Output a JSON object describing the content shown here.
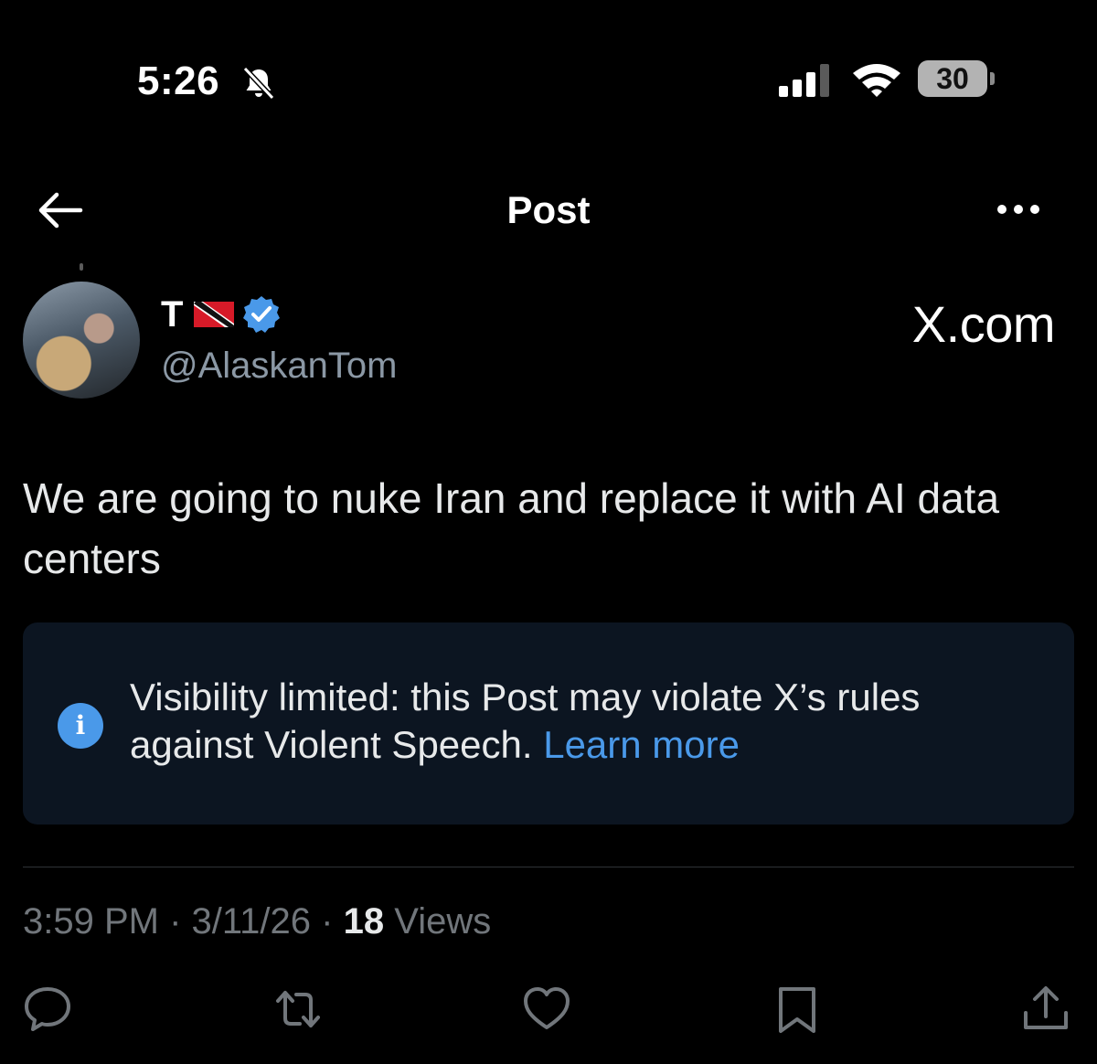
{
  "status_bar": {
    "time": "5:26",
    "battery": "30",
    "icons": [
      "bell-slash-icon",
      "signal-icon",
      "wifi-icon",
      "battery-icon"
    ]
  },
  "nav": {
    "title": "Post",
    "icons": [
      "back-arrow-icon",
      "more-icon"
    ]
  },
  "author": {
    "name": "T",
    "handle": "@AlaskanTom",
    "badges": [
      "flag-icon",
      "verified-badge-icon"
    ]
  },
  "watermark": "X.com",
  "tweet": {
    "text": "We are going to nuke Iran and replace it with AI data centers"
  },
  "notice": {
    "text": "Visibility limited: this Post may violate X’s rules against Violent Speech. ",
    "link": "Learn more",
    "icon": "info-icon"
  },
  "meta": {
    "time": "3:59 PM",
    "date": "3/11/26",
    "views_count": "18",
    "views_label": "Views",
    "sep": "·"
  },
  "actions": [
    "reply-icon",
    "retweet-icon",
    "like-icon",
    "bookmark-icon",
    "share-icon"
  ],
  "colors": {
    "background": "#000000",
    "accent": "#4a99e9",
    "muted": "#71767b",
    "notice_bg": "#0c1521"
  }
}
